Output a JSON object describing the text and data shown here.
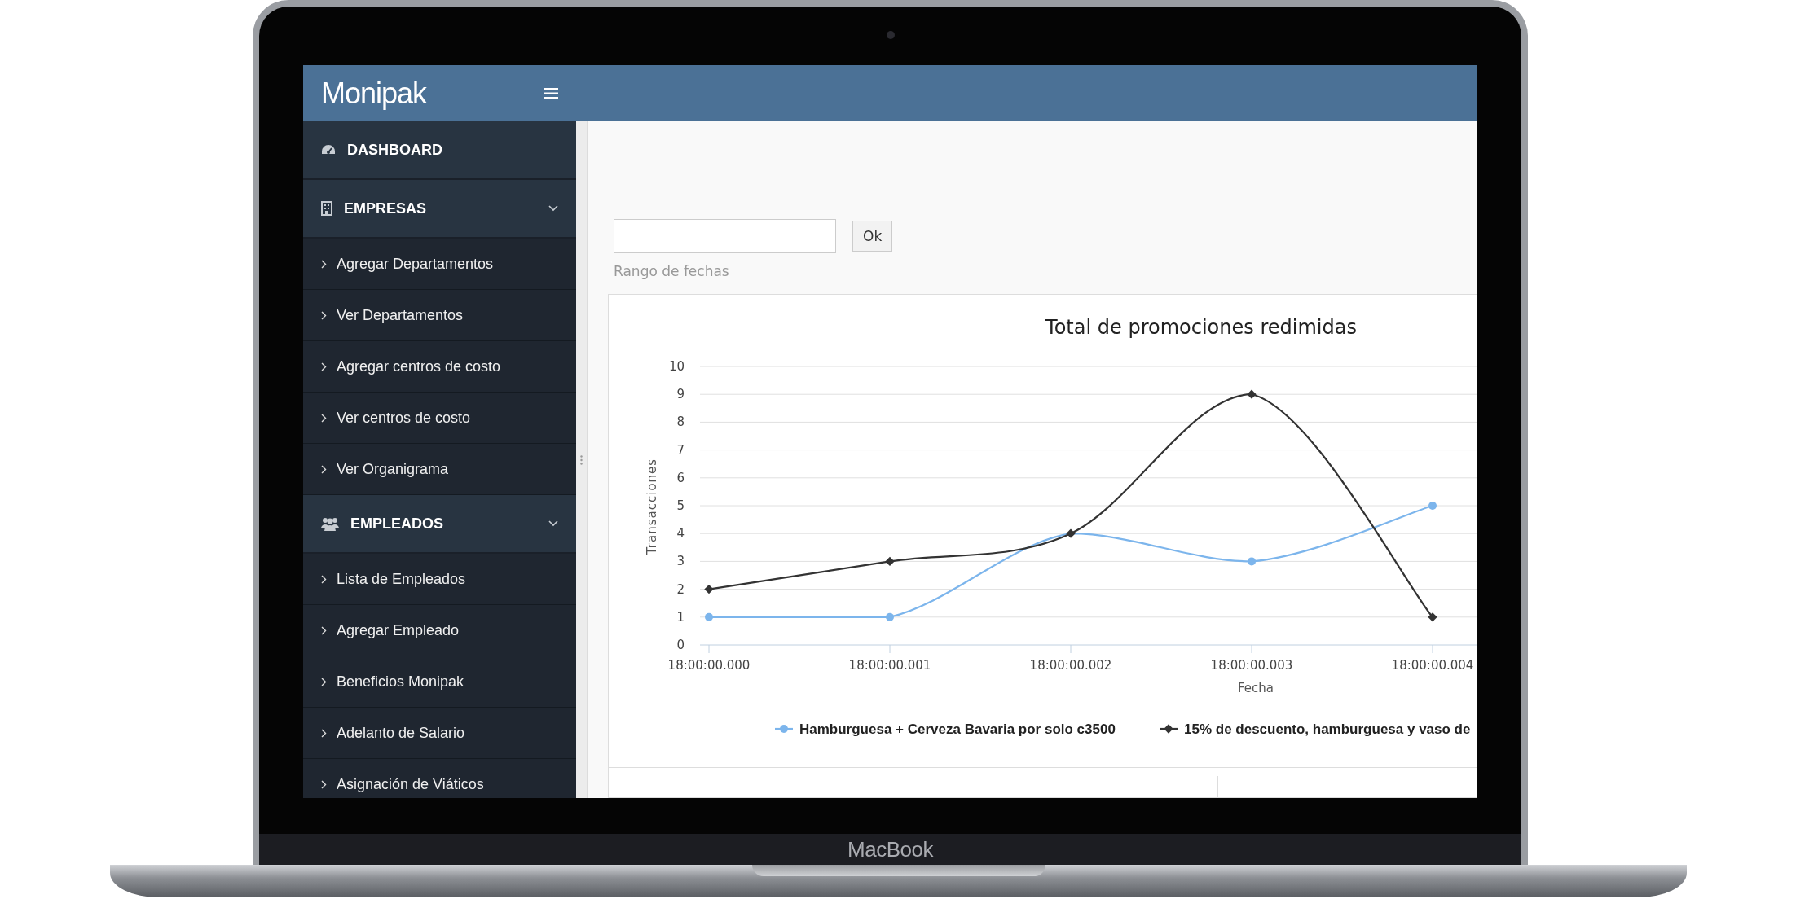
{
  "header": {
    "logo": "Monipak"
  },
  "sidebar": {
    "items": [
      {
        "label": "DASHBOARD"
      },
      {
        "label": "EMPRESAS",
        "expanded": true,
        "children": [
          {
            "label": "Agregar Departamentos"
          },
          {
            "label": "Ver Departamentos"
          },
          {
            "label": "Agregar centros de costo"
          },
          {
            "label": "Ver centros de costo"
          },
          {
            "label": "Ver Organigrama"
          }
        ]
      },
      {
        "label": "EMPLEADOS",
        "expanded": true,
        "children": [
          {
            "label": "Lista de Empleados"
          },
          {
            "label": "Agregar Empleado"
          },
          {
            "label": "Beneficios Monipak"
          },
          {
            "label": "Adelanto de Salario"
          },
          {
            "label": "Asignación de Viáticos"
          }
        ]
      }
    ]
  },
  "filter": {
    "button": "Ok",
    "caption": "Rango de fechas"
  },
  "chart": {
    "chart_data": {
      "type": "line",
      "title": "Total de promociones redimidas",
      "xlabel": "Fecha",
      "ylabel": "Transacciones",
      "categories": [
        "18:00:00.000",
        "18:00:00.001",
        "18:00:00.002",
        "18:00:00.003",
        "18:00:00.004"
      ],
      "yticks": [
        0,
        1,
        2,
        3,
        4,
        5,
        6,
        7,
        8,
        9,
        10
      ],
      "ylim": [
        0,
        10
      ],
      "grid": true,
      "legend": true,
      "series": [
        {
          "name": "Hamburguesa + Cerveza Bavaria por solo c3500",
          "color": "#7cb5ec",
          "marker": "circle",
          "values": [
            1,
            1,
            4,
            3,
            5
          ]
        },
        {
          "name": "15% de descuento, hamburguesa y vaso de",
          "color": "#333333",
          "marker": "diamond",
          "values": [
            2,
            3,
            4,
            9,
            1
          ]
        }
      ]
    }
  },
  "device": {
    "label": "MacBook"
  }
}
